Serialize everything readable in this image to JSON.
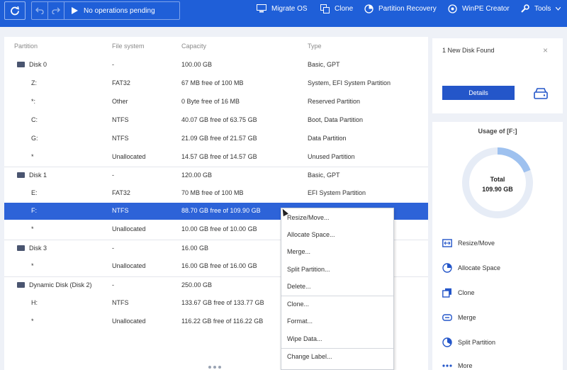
{
  "toolbar": {
    "pending_label": "No operations pending",
    "items": [
      {
        "label": "Migrate OS",
        "icon": "migrate-icon"
      },
      {
        "label": "Clone",
        "icon": "clone-icon"
      },
      {
        "label": "Partition Recovery",
        "icon": "recovery-icon"
      },
      {
        "label": "WinPE Creator",
        "icon": "winpe-icon"
      },
      {
        "label": "Tools",
        "icon": "tools-icon"
      }
    ]
  },
  "table": {
    "headers": [
      "Partition",
      "File system",
      "Capacity",
      "Type"
    ],
    "rows": [
      {
        "partition": "Disk 0",
        "fs": "-",
        "capacity": "100.00 GB",
        "type": "Basic, GPT",
        "disk": true
      },
      {
        "partition": "Z:",
        "fs": "FAT32",
        "capacity": "67 MB free of 100 MB",
        "type": "System, EFI System Partition"
      },
      {
        "partition": "*:",
        "fs": "Other",
        "capacity": "0 Byte free of 16 MB",
        "type": "Reserved Partition"
      },
      {
        "partition": "C:",
        "fs": "NTFS",
        "capacity": "40.07 GB free of 63.75 GB",
        "type": "Boot, Data Partition"
      },
      {
        "partition": "G:",
        "fs": "NTFS",
        "capacity": "21.09 GB free of 21.57 GB",
        "type": "Data Partition"
      },
      {
        "partition": "*",
        "fs": "Unallocated",
        "capacity": "14.57 GB free of 14.57 GB",
        "type": "Unused Partition"
      },
      {
        "partition": "Disk 1",
        "fs": "-",
        "capacity": "120.00 GB",
        "type": "Basic, GPT",
        "disk": true
      },
      {
        "partition": "E:",
        "fs": "FAT32",
        "capacity": "70 MB free of 100 MB",
        "type": "EFI System Partition"
      },
      {
        "partition": "F:",
        "fs": "NTFS",
        "capacity": "88.70 GB free of 109.90 GB",
        "type": "",
        "selected": true
      },
      {
        "partition": "*",
        "fs": "Unallocated",
        "capacity": "10.00 GB free of 10.00 GB",
        "type": ""
      },
      {
        "partition": "Disk 3",
        "fs": "-",
        "capacity": "16.00 GB",
        "type": "",
        "disk": true
      },
      {
        "partition": "*",
        "fs": "Unallocated",
        "capacity": "16.00 GB free of 16.00 GB",
        "type": ""
      },
      {
        "partition": "Dynamic Disk (Disk 2)",
        "fs": "-",
        "capacity": "250.00 GB",
        "type": "",
        "disk": true
      },
      {
        "partition": "H:",
        "fs": "NTFS",
        "capacity": "133.67 GB free of   133.77 GB",
        "type": ""
      },
      {
        "partition": "*",
        "fs": "Unallocated",
        "capacity": "116.22 GB free of   116.22 GB",
        "type": ""
      }
    ]
  },
  "context_menu": {
    "items": [
      "Resize/Move...",
      "Allocate Space...",
      "Merge...",
      "Split Partition...",
      "Delete...",
      "Clone...",
      "Format...",
      "Wipe Data...",
      "Change Label..."
    ]
  },
  "notice": {
    "text": "1 New Disk Found",
    "details_label": "Details"
  },
  "usage": {
    "title": "Usage of [F:]",
    "total_label": "Total",
    "total_value": "109.90 GB",
    "used_fraction": 0.19
  },
  "actions": [
    {
      "label": "Resize/Move",
      "icon": "resize-icon"
    },
    {
      "label": "Allocate Space",
      "icon": "allocate-icon"
    },
    {
      "label": "Clone",
      "icon": "clone-icon"
    },
    {
      "label": "Merge",
      "icon": "merge-icon"
    },
    {
      "label": "Split Partition",
      "icon": "split-icon"
    },
    {
      "label": "More",
      "icon": "more-icon"
    }
  ],
  "colors": {
    "primary": "#1f5fd8",
    "selected_row": "#2d63d8",
    "donut_track": "#e6ecf6",
    "donut_used": "#9ec1ef"
  }
}
